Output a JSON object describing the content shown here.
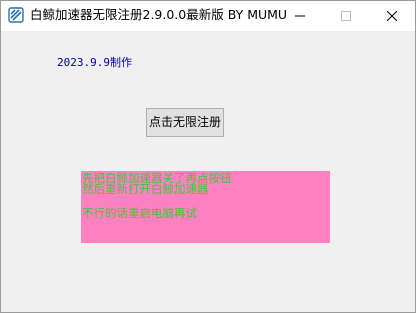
{
  "window": {
    "title": "白鲸加速器无限注册2.9.0.0最新版 BY MUMU",
    "icon": "app-logo-icon",
    "controls": {
      "minimize_icon": "minimize-icon",
      "maximize_icon": "maximize-icon",
      "close_icon": "close-icon"
    }
  },
  "main": {
    "date_label": "2023.9.9制作",
    "register_button": "点击无限注册",
    "info": {
      "line1": "先把白鲸加速器关了再点按钮",
      "line2": "然后重新打开白鲸加速器",
      "line3": "不行的话重启电脑再试"
    }
  },
  "colors": {
    "background": "#f0f0f0",
    "titlebar": "#ffffff",
    "date_text": "#0000a0",
    "info_panel": "#ff80c0",
    "info_text": "#3cc83c"
  }
}
